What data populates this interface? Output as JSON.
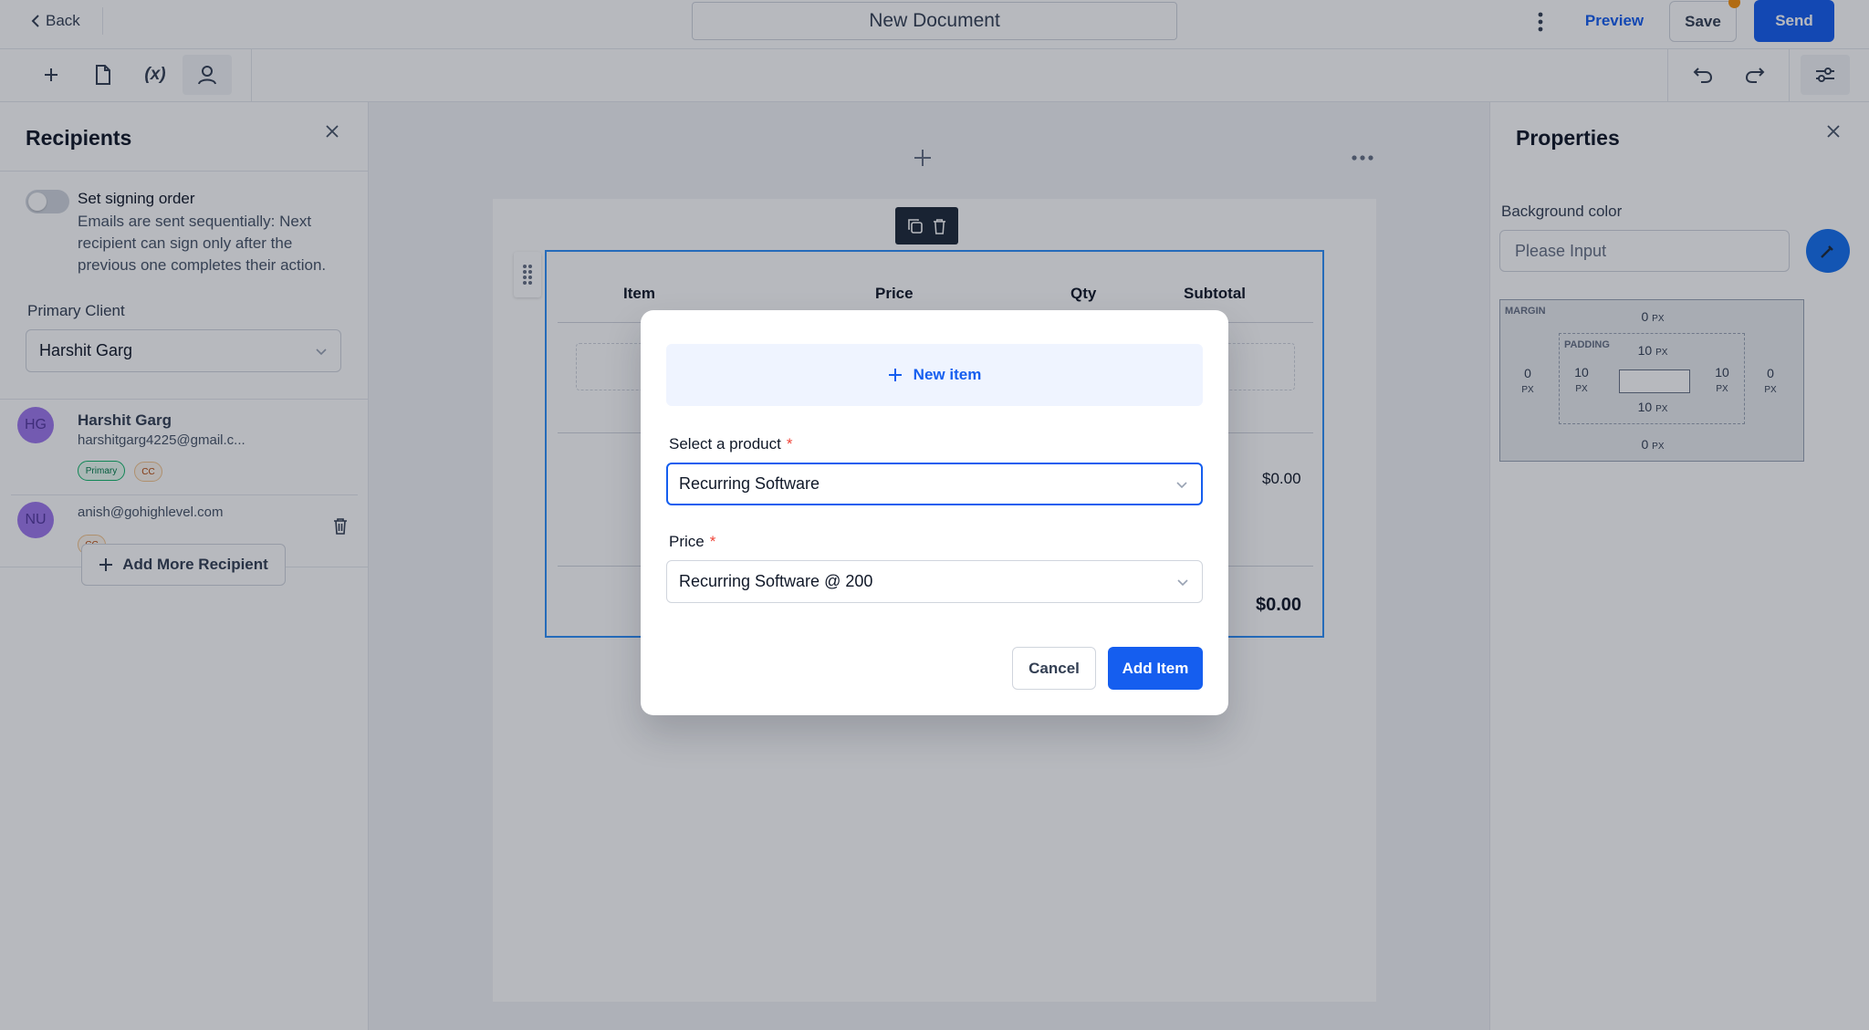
{
  "topbar": {
    "back_label": "Back",
    "document_title": "New Document",
    "preview_label": "Preview",
    "save_label": "Save",
    "send_label": "Send"
  },
  "toolbar": {
    "variables_label": "(x)"
  },
  "recipients_panel": {
    "title": "Recipients",
    "signing_order_label": "Set signing order",
    "signing_order_enabled": false,
    "signing_order_description": "Emails are sent sequentially: Next recipient can sign only after the previous one completes their action.",
    "primary_client_label": "Primary Client",
    "primary_client_value": "Harshit Garg",
    "recipients": [
      {
        "initials": "HG",
        "name": "Harshit Garg",
        "email": "harshitgarg4225@gmail.c...",
        "badges": [
          "Primary",
          "CC"
        ]
      },
      {
        "initials": "NU",
        "name": "",
        "email": "anish@gohighlevel.com",
        "badges": [
          "CC"
        ]
      }
    ],
    "add_recipient_label": "Add More Recipient"
  },
  "document_table": {
    "columns": [
      "Item",
      "Price",
      "Qty",
      "Subtotal"
    ],
    "row_subtotal": "$0.00",
    "total": "$0.00"
  },
  "properties_panel": {
    "title": "Properties",
    "background_color_label": "Background color",
    "background_color_placeholder": "Please Input",
    "margin_label": "MARGIN",
    "padding_label": "PADDING",
    "unit": "PX",
    "margin": {
      "top": "0",
      "right": "0",
      "bottom": "0",
      "left": "0"
    },
    "padding": {
      "top": "10",
      "right": "10",
      "bottom": "10",
      "left": "10"
    }
  },
  "modal": {
    "new_item_label": "New item",
    "product_label": "Select a product",
    "product_value": "Recurring Software",
    "price_label": "Price",
    "price_value": "Recurring Software @ 200",
    "required_marker": "*",
    "cancel_label": "Cancel",
    "add_label": "Add Item"
  },
  "colors": {
    "accent": "#155eef",
    "save_notification": "#f79009",
    "selection_border": "#2e90fa"
  }
}
